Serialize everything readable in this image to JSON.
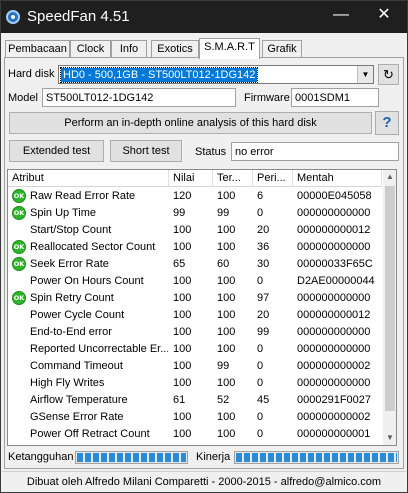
{
  "window": {
    "title": "SpeedFan 4.51",
    "minimize": "—",
    "close": "✕"
  },
  "tabs": [
    "Pembacaan",
    "Clock",
    "Info",
    "Exotics",
    "S.M.A.R.T",
    "Grafik"
  ],
  "active_tab": "S.M.A.R.T",
  "hard_disk": {
    "label": "Hard disk",
    "selected": "HD0 - 500,1GB - ST500LT012-1DG142"
  },
  "model": {
    "label": "Model",
    "value": "ST500LT012-1DG142"
  },
  "firmware": {
    "label": "Firmware",
    "value": "0001SDM1"
  },
  "analysis_button": "Perform an in-depth online analysis of this hard disk",
  "help_button": "?",
  "extended_test_button": "Extended test",
  "short_test_button": "Short test",
  "status": {
    "label": "Status",
    "value": "no error"
  },
  "table": {
    "columns": [
      "Atribut",
      "Nilai",
      "Ter...",
      "Peri...",
      "Mentah"
    ],
    "rows": [
      {
        "ok": true,
        "atribut": "Raw Read Error Rate",
        "nilai": "120",
        "ter": "100",
        "peri": "6",
        "mentah": "00000E045058"
      },
      {
        "ok": true,
        "atribut": "Spin Up Time",
        "nilai": "99",
        "ter": "99",
        "peri": "0",
        "mentah": "000000000000"
      },
      {
        "ok": false,
        "atribut": "Start/Stop Count",
        "nilai": "100",
        "ter": "100",
        "peri": "20",
        "mentah": "000000000012"
      },
      {
        "ok": true,
        "atribut": "Reallocated Sector Count",
        "nilai": "100",
        "ter": "100",
        "peri": "36",
        "mentah": "000000000000"
      },
      {
        "ok": true,
        "atribut": "Seek Error Rate",
        "nilai": "65",
        "ter": "60",
        "peri": "30",
        "mentah": "00000033F65C"
      },
      {
        "ok": false,
        "atribut": "Power On Hours Count",
        "nilai": "100",
        "ter": "100",
        "peri": "0",
        "mentah": "D2AE00000044"
      },
      {
        "ok": true,
        "atribut": "Spin Retry Count",
        "nilai": "100",
        "ter": "100",
        "peri": "97",
        "mentah": "000000000000"
      },
      {
        "ok": false,
        "atribut": "Power Cycle Count",
        "nilai": "100",
        "ter": "100",
        "peri": "20",
        "mentah": "000000000012"
      },
      {
        "ok": false,
        "atribut": "End-to-End error",
        "nilai": "100",
        "ter": "100",
        "peri": "99",
        "mentah": "000000000000"
      },
      {
        "ok": false,
        "atribut": "Reported Uncorrectable Er...",
        "nilai": "100",
        "ter": "100",
        "peri": "0",
        "mentah": "000000000000"
      },
      {
        "ok": false,
        "atribut": "Command Timeout",
        "nilai": "100",
        "ter": "99",
        "peri": "0",
        "mentah": "000000000002"
      },
      {
        "ok": false,
        "atribut": "High Fly Writes",
        "nilai": "100",
        "ter": "100",
        "peri": "0",
        "mentah": "000000000000"
      },
      {
        "ok": false,
        "atribut": "Airflow Temperature",
        "nilai": "61",
        "ter": "52",
        "peri": "45",
        "mentah": "0000291F0027"
      },
      {
        "ok": false,
        "atribut": "GSense Error Rate",
        "nilai": "100",
        "ter": "100",
        "peri": "0",
        "mentah": "000000000002"
      },
      {
        "ok": false,
        "atribut": "Power Off Retract Count",
        "nilai": "100",
        "ter": "100",
        "peri": "0",
        "mentah": "000000000001"
      }
    ]
  },
  "ok_icon_text": "OK",
  "fitness": {
    "label": "Ketangguhan",
    "level_percent": 100
  },
  "performance": {
    "label": "Kinerja",
    "level_percent": 100
  },
  "footer": "Dibuat oleh Alfredo Milani Comparetti - 2000-2015 - alfredo@almico.com",
  "colors": {
    "selection": "#0078d7",
    "ok_green": "#2fb52a",
    "bar_blue": "#2a8cd8",
    "titlebar": "#1f1f1f"
  }
}
